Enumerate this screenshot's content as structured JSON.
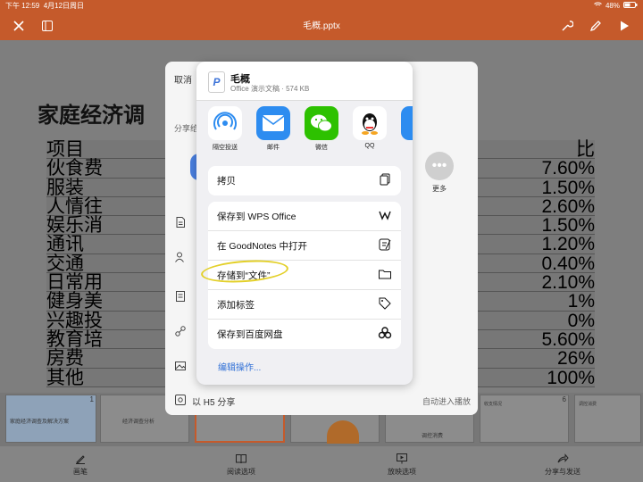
{
  "status_bar": {
    "time": "下午 12:59",
    "date": "4月12日周日",
    "battery": "48%"
  },
  "title_bar": {
    "title": "毛概.pptx"
  },
  "slide": {
    "title": "家庭经济调",
    "left_col": [
      "项目",
      "伙食费",
      "服装",
      "人情往",
      "娱乐消",
      "通讯",
      "交通",
      "日常用",
      "健身美",
      "兴趣投",
      "教育培",
      "房费",
      "其他"
    ],
    "right_col": [
      "比",
      "7.60%",
      "1.50%",
      "2.60%",
      "1.50%",
      "1.20%",
      "0.40%",
      "2.10%",
      "1%",
      "0%",
      "5.60%",
      "26%",
      "100%"
    ]
  },
  "thumbnails": [
    {
      "num": "1",
      "text": "家庭经济调查及解决方案"
    },
    {
      "num": "",
      "text": "经济调查分析"
    },
    {
      "num": "",
      "text": ""
    },
    {
      "num": "",
      "text": ""
    },
    {
      "num": "",
      "text": "调控消费"
    },
    {
      "num": "6",
      "text": "收支情况"
    },
    {
      "num": "",
      "text": "调控消费"
    }
  ],
  "bottom_bar": {
    "items": [
      {
        "label": "画笔",
        "icon": "pen-icon"
      },
      {
        "label": "阅读选项",
        "icon": "book-icon"
      },
      {
        "label": "放映选项",
        "icon": "play-options-icon"
      },
      {
        "label": "分享与发送",
        "icon": "share-icon"
      }
    ]
  },
  "share_panel": {
    "cancel": "取消",
    "share_label": "分享给",
    "more": "更多",
    "h5_share": "以 H5 分享",
    "auto_play": "自动进入播放"
  },
  "share_sheet": {
    "file_name": "毛概",
    "file_meta": "Office 演示文稿 · 574 KB",
    "apps": [
      {
        "label": "隔空投送",
        "icon": "airdrop-icon",
        "color": "#ffffff"
      },
      {
        "label": "邮件",
        "icon": "mail-icon",
        "color": "#2d8cf0"
      },
      {
        "label": "微信",
        "icon": "wechat-icon",
        "color": "#2dc100"
      },
      {
        "label": "QQ",
        "icon": "qq-icon",
        "color": "#ffffff"
      },
      {
        "label": "",
        "icon": "app-icon",
        "color": "#2d8cf0"
      }
    ],
    "copy": "拷贝",
    "actions": [
      {
        "label": "保存到 WPS Office",
        "icon": "wps-icon"
      },
      {
        "label": "在 GoodNotes 中打开",
        "icon": "goodnotes-icon"
      },
      {
        "label": "存储到“文件”",
        "icon": "folder-icon"
      },
      {
        "label": "添加标签",
        "icon": "tag-icon"
      },
      {
        "label": "保存到百度网盘",
        "icon": "baidu-icon"
      }
    ],
    "edit_actions": "编辑操作..."
  }
}
